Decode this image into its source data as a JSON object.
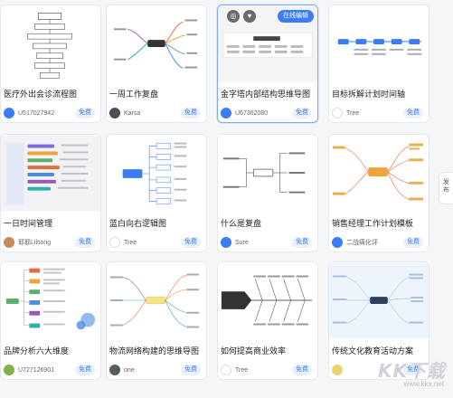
{
  "cards": [
    {
      "title": "医疗外出会诊流程图",
      "author": "U517027942",
      "free": "免费",
      "avatar_color": "#3d7bf7"
    },
    {
      "title": "一周工作复盘",
      "author": "Karsa",
      "free": "免费",
      "avatar_color": "#4a4f57"
    },
    {
      "title": "金字塔内部结构思维导图",
      "author": "U67362080",
      "free": "免费",
      "avatar_color": "#3d7bf7",
      "edit_label": "在线编辑"
    },
    {
      "title": "目标拆解计划时间轴",
      "author": "Tree",
      "free": "免费",
      "avatar_color": "#ffffff"
    },
    {
      "title": "一日时间管理",
      "author": "耶耶Lilsong",
      "free": "免费",
      "avatar_color": "#c78a5a"
    },
    {
      "title": "蓝白向右逻辑图",
      "author": "Tree",
      "free": "免费",
      "avatar_color": "#ffffff"
    },
    {
      "title": "什么是复盘",
      "author": "Sure",
      "free": "免费",
      "avatar_color": "#3d7bf7"
    },
    {
      "title": "销售经理工作计划模板",
      "author": "二战痛化评",
      "free": "免费",
      "avatar_color": "#3d7bf7"
    },
    {
      "title": "品牌分析六大维度",
      "author": "U727126901",
      "free": "免费",
      "avatar_color": "#7fb24a"
    },
    {
      "title": "物流网络构建的思维导图",
      "author": "one",
      "free": "免费",
      "avatar_color": "#555b63"
    },
    {
      "title": "如何提高商业效率",
      "author": "Tree",
      "free": "免费",
      "avatar_color": "#ffffff"
    },
    {
      "title": "传统文化教育活动方案",
      "author": "",
      "free": "免费",
      "avatar_color": "#e9d36a"
    }
  ],
  "side_tab": "发布",
  "watermark": {
    "logo": "KK下载",
    "url": "www.kkx.net"
  }
}
